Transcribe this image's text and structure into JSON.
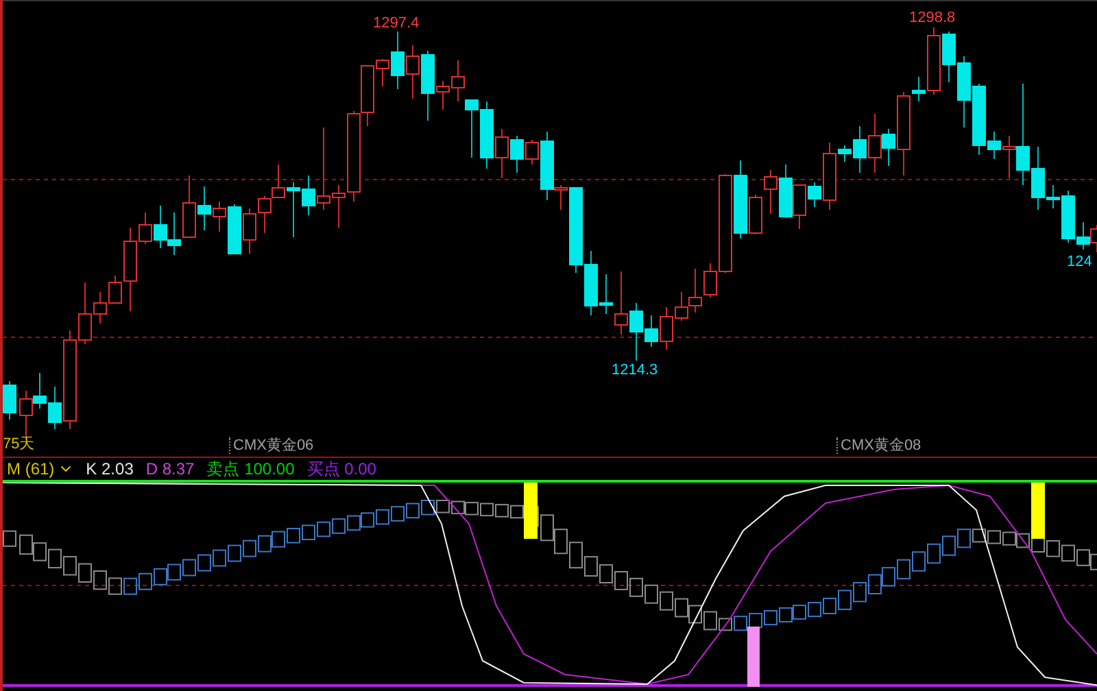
{
  "price_chart": {
    "period_label": "75天",
    "price_labels": [
      {
        "kind": "high",
        "text": "1297.4"
      },
      {
        "kind": "low",
        "text": "1214.3"
      },
      {
        "kind": "high",
        "text": "1298.8"
      },
      {
        "kind": "low",
        "text": "124"
      }
    ],
    "contract_labels": [
      "CMX黄金06",
      "CMX黄金08"
    ]
  },
  "indicator_legend": [
    {
      "label": "M (61)",
      "color": "#d8c000"
    },
    {
      "label": "K",
      "value": "2.03",
      "color": "#e8e8e8"
    },
    {
      "label": "D",
      "value": "8.37",
      "color": "#d040e0"
    },
    {
      "label": "卖点",
      "value": "100.00",
      "color": "#00d000"
    },
    {
      "label": "买点",
      "value": "0.00",
      "color": "#a020f0"
    }
  ]
}
